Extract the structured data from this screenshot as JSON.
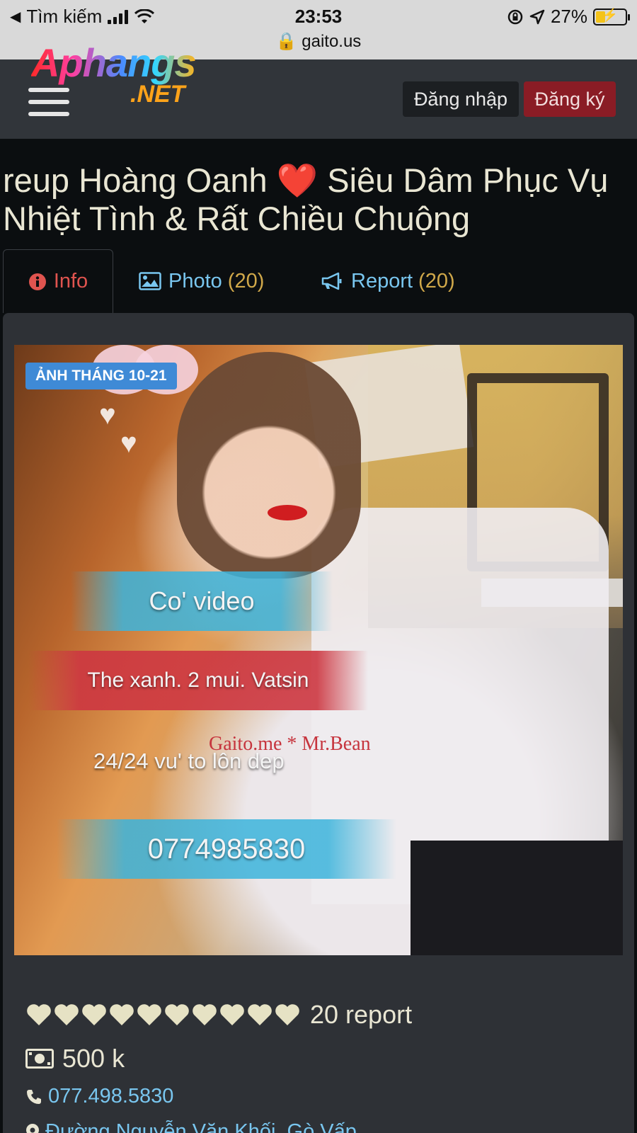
{
  "status_bar": {
    "back_label": "Tìm kiếm",
    "time": "23:53",
    "battery": "27%",
    "url": "gaito.us"
  },
  "navbar": {
    "logo_main": "Aphangs",
    "logo_suffix": ".NET",
    "login_label": "Đăng nhập",
    "register_label": "Đăng ký"
  },
  "page": {
    "title": "reup Hoàng Oanh ❤️ Siêu Dâm Phục Vụ Nhiệt Tình & Rất Chiều Chuộng"
  },
  "tabs": [
    {
      "label": "Info",
      "icon": "info-circle-icon"
    },
    {
      "label": "Photo",
      "count": "(20)",
      "icon": "image-icon"
    },
    {
      "label": "Report",
      "count": "(20)",
      "icon": "megaphone-icon"
    }
  ],
  "photo": {
    "badge": "ẢNH THÁNG 10-21",
    "overlay_video": "Co' video",
    "overlay_card": "The xanh. 2 mui. Vatsin",
    "overlay_watermark": "Gaito.me * Mr.Bean",
    "overlay_hours": "24/24 vu' to lôn dep",
    "overlay_phone": "0774985830"
  },
  "details": {
    "heart_count": 10,
    "heart_color": "#e6e2c4",
    "report_label": "20 report",
    "price": "500 k",
    "phone": "077.498.5830",
    "address": "Đường Nguyễn Văn Khối, Gò Vấp"
  }
}
